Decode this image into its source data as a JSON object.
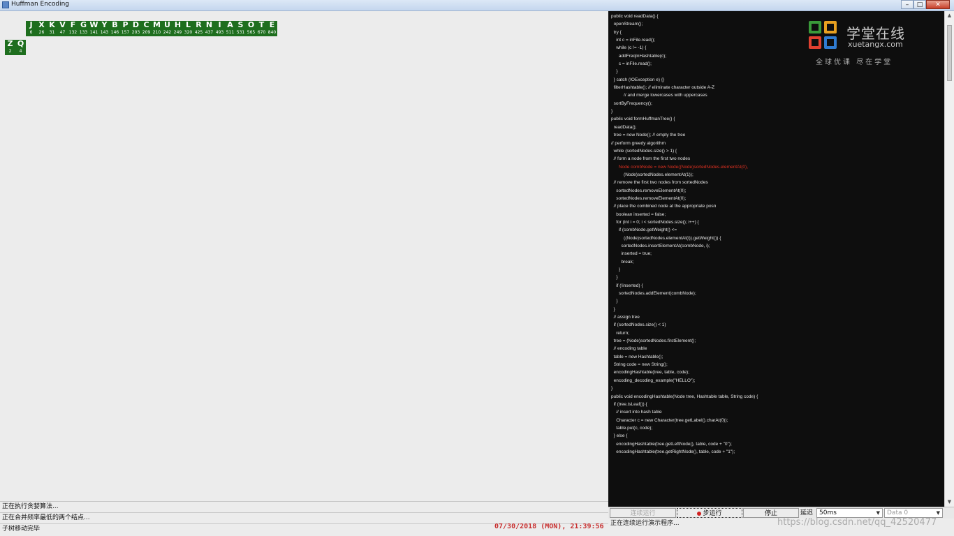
{
  "window": {
    "title": "Huffman Encoding",
    "min": "–",
    "max": "□",
    "close": "✕"
  },
  "nodes_row1": [
    {
      "ch": "J",
      "freq": "6"
    },
    {
      "ch": "X",
      "freq": "26"
    },
    {
      "ch": "K",
      "freq": "31"
    },
    {
      "ch": "V",
      "freq": "47"
    },
    {
      "ch": "F",
      "freq": "132"
    },
    {
      "ch": "G",
      "freq": "133"
    },
    {
      "ch": "W",
      "freq": "141"
    },
    {
      "ch": "Y",
      "freq": "143"
    },
    {
      "ch": "B",
      "freq": "146"
    },
    {
      "ch": "P",
      "freq": "157"
    },
    {
      "ch": "D",
      "freq": "203"
    },
    {
      "ch": "C",
      "freq": "209"
    },
    {
      "ch": "M",
      "freq": "210"
    },
    {
      "ch": "U",
      "freq": "242"
    },
    {
      "ch": "H",
      "freq": "249"
    },
    {
      "ch": "L",
      "freq": "320"
    },
    {
      "ch": "R",
      "freq": "425"
    },
    {
      "ch": "N",
      "freq": "437"
    },
    {
      "ch": "I",
      "freq": "493"
    },
    {
      "ch": "A",
      "freq": "511"
    },
    {
      "ch": "S",
      "freq": "531"
    },
    {
      "ch": "O",
      "freq": "565"
    },
    {
      "ch": "T",
      "freq": "670"
    },
    {
      "ch": "E",
      "freq": "840"
    }
  ],
  "nodes_row2": [
    {
      "ch": "Z",
      "freq": "2"
    },
    {
      "ch": "Q",
      "freq": "4"
    }
  ],
  "status": {
    "line1": "正在执行贪婪算法...",
    "line2": "正在合并频率最低的两个结点...",
    "line3": "子树移动完毕",
    "timestamp": "07/30/2018 (MON), 21:39:56"
  },
  "logo": {
    "name_cn": "学堂在线",
    "name_en": "xuetangx.com",
    "slogan": "全球优课 尽在学堂"
  },
  "code_lines": [
    "public void readData() {",
    "  openStream();",
    "  try {",
    "    int c = inFile.read();",
    "    while (c != -1) {",
    "      addFreqInHashtable(c);",
    "      c = inFile.read();",
    "    }",
    "  } catch (IOException e) {}",
    "  filterHashtable(); // eliminate character outside A-Z",
    "          // and merge lowercases with uppercases",
    "  sortByFrequency();",
    "}",
    "",
    "public void formHuffmanTree() {",
    "  readData();",
    "  tree = new Node(); // empty the tree",
    "",
    "// perform greedy algorithm",
    "  while (sortedNodes.size() > 1) {",
    "  // form a node from the first two nodes",
    "      Node combNode = new Node((Node)sortedNodes.elementAt(0),",
    "          (Node)sortedNodes.elementAt(1));",
    "  // remove the first two nodes from sortedNodes",
    "    sortedNodes.removeElementAt(0);",
    "    sortedNodes.removeElementAt(0);",
    "",
    "  // place the combined node at the appropriate posn",
    "    boolean inserted = false;",
    "    for (int i = 0; i < sortedNodes.size(); i++) {",
    "      if (combNode.getWeight() <=",
    "          ((Node)sortedNodes.elementAt(i)).getWeight()) {",
    "        sortedNodes.insertElementAt(combNode, i);",
    "        inserted = true;",
    "        break;",
    "      }",
    "    }",
    "    if (!inserted) {",
    "      sortedNodes.addElement(combNode);",
    "    }",
    "  }",
    "",
    "  // assign tree",
    "  if (sortedNodes.size() < 1)",
    "    return;",
    "  tree = (Node)sortedNodes.firstElement();",
    "",
    "  // encoding table",
    "  table = new Hashtable();",
    "  String code = new String();",
    "  encodingHashtable(tree, table, code);",
    "  encoding_decoding_example(\"HELLO\");",
    "}",
    "",
    "",
    "public void encodingHashtable(Node tree, Hashtable table, String code) {",
    "  if (tree.isLeaf()) {",
    "    // insert into hash table",
    "    Character c = new Character(tree.getLabel().charAt(0));",
    "    table.put(c, code);",
    "  } else {",
    "    encodingHashtable(tree.getLeftNode(), table, code + \"0\");",
    "    encodingHashtable(tree.getRightNode(), table, code + \"1\");"
  ],
  "highlight_line_index": 21,
  "controls": {
    "continuous_run": "连续运行",
    "step_run": "步运行",
    "stop": "停止",
    "delay_label": "延迟",
    "delay_value": "50ms",
    "data_value": "Data 0",
    "caret": "▼",
    "panel_status": "正在连续运行演示程序..."
  },
  "watermark": "https://blog.csdn.net/qq_42520477",
  "scrollbar": {
    "up": "▲",
    "down": "▼"
  },
  "colors": {
    "node_bg": "#1e6e1e",
    "code_bg": "#0e0e0e",
    "highlight": "#e03020",
    "timestamp": "#c83030"
  }
}
